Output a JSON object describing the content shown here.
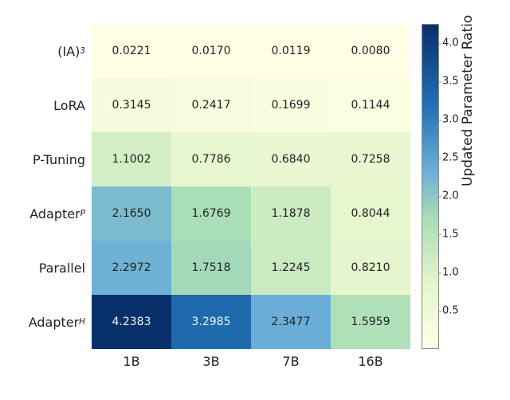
{
  "chart_data": {
    "type": "heatmap",
    "title": "",
    "xlabel": "",
    "ylabel": "",
    "colorbar_label": "Updated Parameter Ratio",
    "x_categories": [
      "1B",
      "3B",
      "7B",
      "16B"
    ],
    "y_categories_plain": [
      "(IA)^3",
      "LoRA",
      "P-Tuning",
      "Adapter^P",
      "Parallel",
      "Adapter^H"
    ],
    "y_categories_html": [
      "(IA)<span class='sup'>3</span>",
      "LoRA",
      "P-Tuning",
      "Adapter<span class='sup'>P</span>",
      "Parallel",
      "Adapter<span class='sup'>H</span>"
    ],
    "values": [
      [
        0.0221,
        0.017,
        0.0119,
        0.008
      ],
      [
        0.3145,
        0.2417,
        0.1699,
        0.1144
      ],
      [
        1.1002,
        0.7786,
        0.684,
        0.7258
      ],
      [
        2.165,
        1.6769,
        1.1878,
        0.8044
      ],
      [
        2.2972,
        1.7518,
        1.2245,
        0.821
      ],
      [
        4.2383,
        3.2985,
        2.3477,
        1.5959
      ]
    ],
    "value_range": [
      0.0,
      4.25
    ],
    "colorbar_ticks": [
      0.5,
      1.0,
      1.5,
      2.0,
      2.5,
      3.0,
      3.5,
      4.0
    ]
  }
}
